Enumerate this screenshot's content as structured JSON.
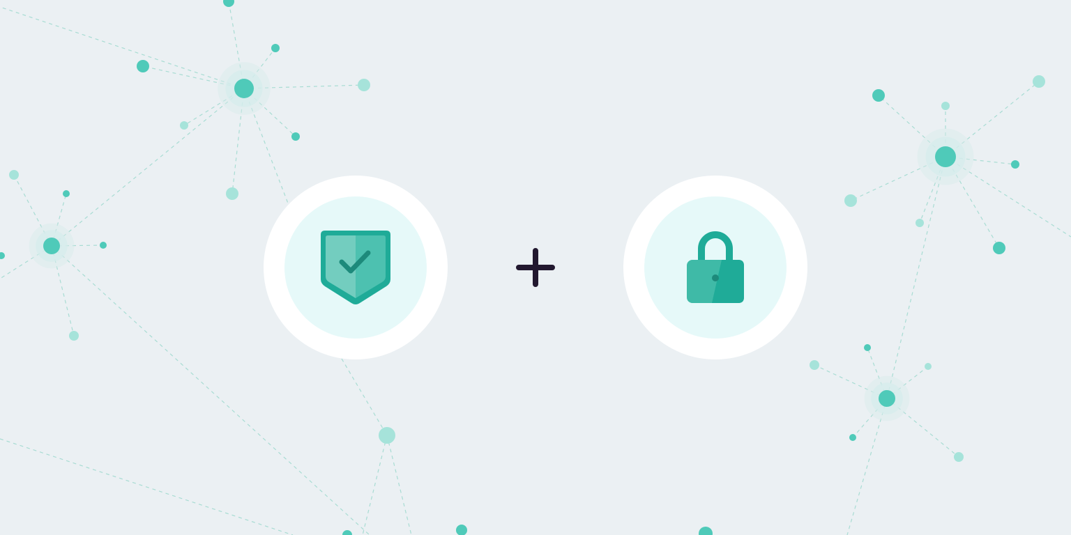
{
  "colors": {
    "background": "#ebf0f3",
    "network_node": "#4fcab9",
    "network_node_light": "#a6e3da",
    "network_line": "#a8dcd3",
    "halo": "#d6ecec",
    "badge_ring": "#ffffff",
    "badge_fill": "#e6f9f9",
    "shield_dark": "#1fab98",
    "shield_mid": "#4dc1b0",
    "shield_light": "#73cdbf",
    "check": "#1d8a7b",
    "lock_body": "#3fbaa7",
    "lock_body_shade": "#1fab98",
    "lock_keyhole": "#1d8a7b",
    "plus": "#22182f"
  },
  "icons": {
    "left": "shield-check-icon",
    "operator": "plus-icon",
    "right": "padlock-icon"
  }
}
